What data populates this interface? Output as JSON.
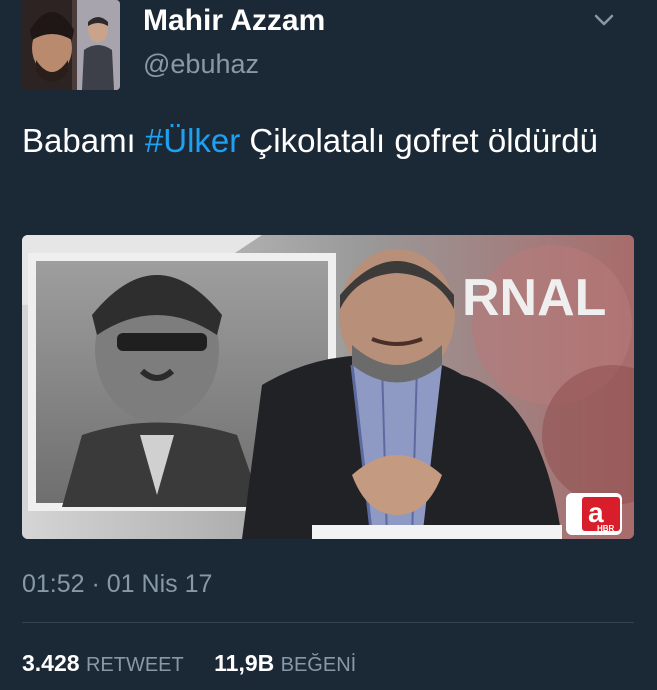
{
  "user": {
    "display_name": "Mahir Azzam",
    "username": "@ebuhaz"
  },
  "tweet": {
    "text_before": "Babamı ",
    "hashtag": "#Ülker",
    "text_after": " Çikolatalı gofret öldürdü",
    "timestamp": "01:52 · 01 Nis 17"
  },
  "media": {
    "channel_logo_letter": "a",
    "channel_logo_sub": "HBR",
    "background_text": "RNAL"
  },
  "stats": {
    "retweet_count": "3.428",
    "retweet_label": "RETWEET",
    "like_count": "11,9B",
    "like_label": "BEĞENİ"
  },
  "icons": {
    "menu": "chevron-down-icon"
  },
  "colors": {
    "background": "#1b2836",
    "secondary_text": "#8899a6",
    "hashtag": "#1da1f2",
    "divider": "#38444d"
  }
}
